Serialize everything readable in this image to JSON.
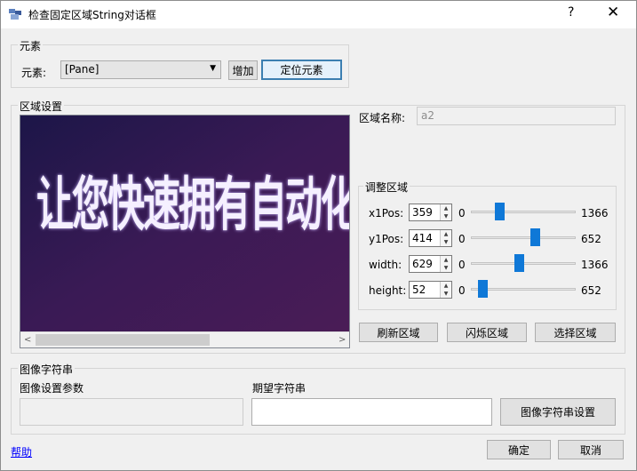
{
  "window": {
    "title": "检查固定区域String对话框",
    "help_glyph": "?",
    "close_glyph": "✕"
  },
  "element_group": {
    "title": "元素",
    "label": "元素:",
    "combo_value": "[Pane]",
    "add_button": "增加",
    "locate_button": "定位元素"
  },
  "region_group": {
    "title": "区域设置",
    "preview_text": "让您快速拥有自动化测试环境，源",
    "name_label": "区域名称:",
    "name_value": "a2",
    "scroll_left": "<",
    "scroll_right": ">"
  },
  "adjust_group": {
    "title": "调整区域",
    "rows": [
      {
        "label": "x1Pos:",
        "value": "359",
        "min": "0",
        "max": "1366",
        "fraction": 0.263
      },
      {
        "label": "y1Pos:",
        "value": "414",
        "min": "0",
        "max": "652",
        "fraction": 0.635
      },
      {
        "label": "width:",
        "value": "629",
        "min": "0",
        "max": "1366",
        "fraction": 0.46
      },
      {
        "label": "height:",
        "value": "52",
        "min": "0",
        "max": "652",
        "fraction": 0.08
      }
    ]
  },
  "region_buttons": {
    "refresh": "刷新区域",
    "flash": "闪烁区域",
    "select": "选择区域"
  },
  "image_string_group": {
    "title": "图像字符串",
    "params_label": "图像设置参数",
    "expected_label": "期望字符串",
    "settings_button": "图像字符串设置"
  },
  "footer": {
    "help": "帮助",
    "ok": "确定",
    "cancel": "取消"
  },
  "colors": {
    "accent": "#0f78d7",
    "default_border": "#3c7fb1",
    "link": "#0000ff",
    "preview_bg": "#2a1638"
  }
}
